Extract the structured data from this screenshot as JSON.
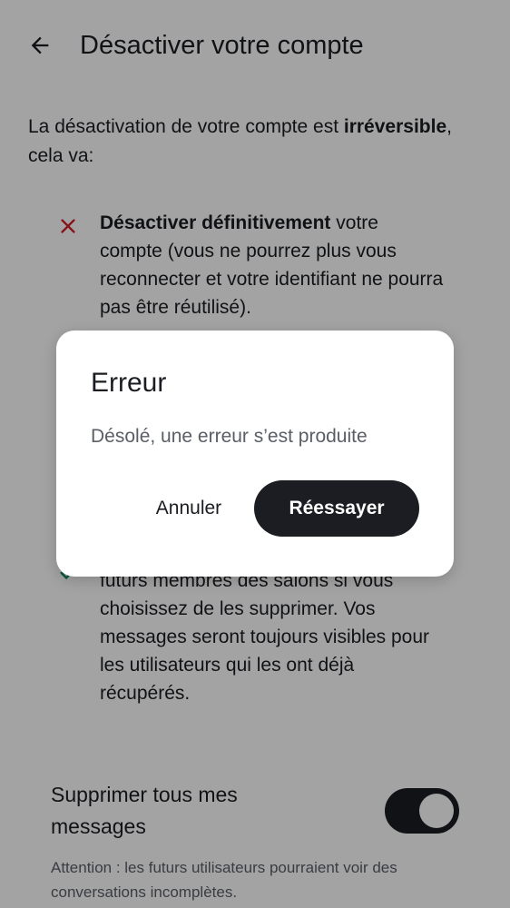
{
  "header": {
    "title": "Désactiver votre compte",
    "back_icon": "arrow-left-icon"
  },
  "intro": {
    "text_before": "La désactivation de votre compte est ",
    "text_bold": "irréversible",
    "text_after": ", cela va:"
  },
  "consequences": [
    {
      "icon": "cross-icon",
      "icon_color": "#d51928",
      "bold": "Désactiver définitivement",
      "text": " votre compte (vous ne pourrez plus vous reconnecter et votre identifiant ne pourra pas être réutilisé)."
    },
    {
      "icon": "check-icon",
      "icon_color": "#0b8a5f",
      "text_partial": "futurs membres des salons si vous choisissez de les supprimer. Vos messages seront toujours visibles pour les utilisateurs qui les ont déjà récupérés."
    }
  ],
  "delete_messages": {
    "label": "Supprimer tous mes messages",
    "enabled": true
  },
  "warning": "Attention : les futurs utilisateurs pourraient voir des conversations incomplètes.",
  "dialog": {
    "title": "Erreur",
    "message": "Désolé, une erreur s’est produite",
    "cancel_label": "Annuler",
    "retry_label": "Réessayer"
  }
}
